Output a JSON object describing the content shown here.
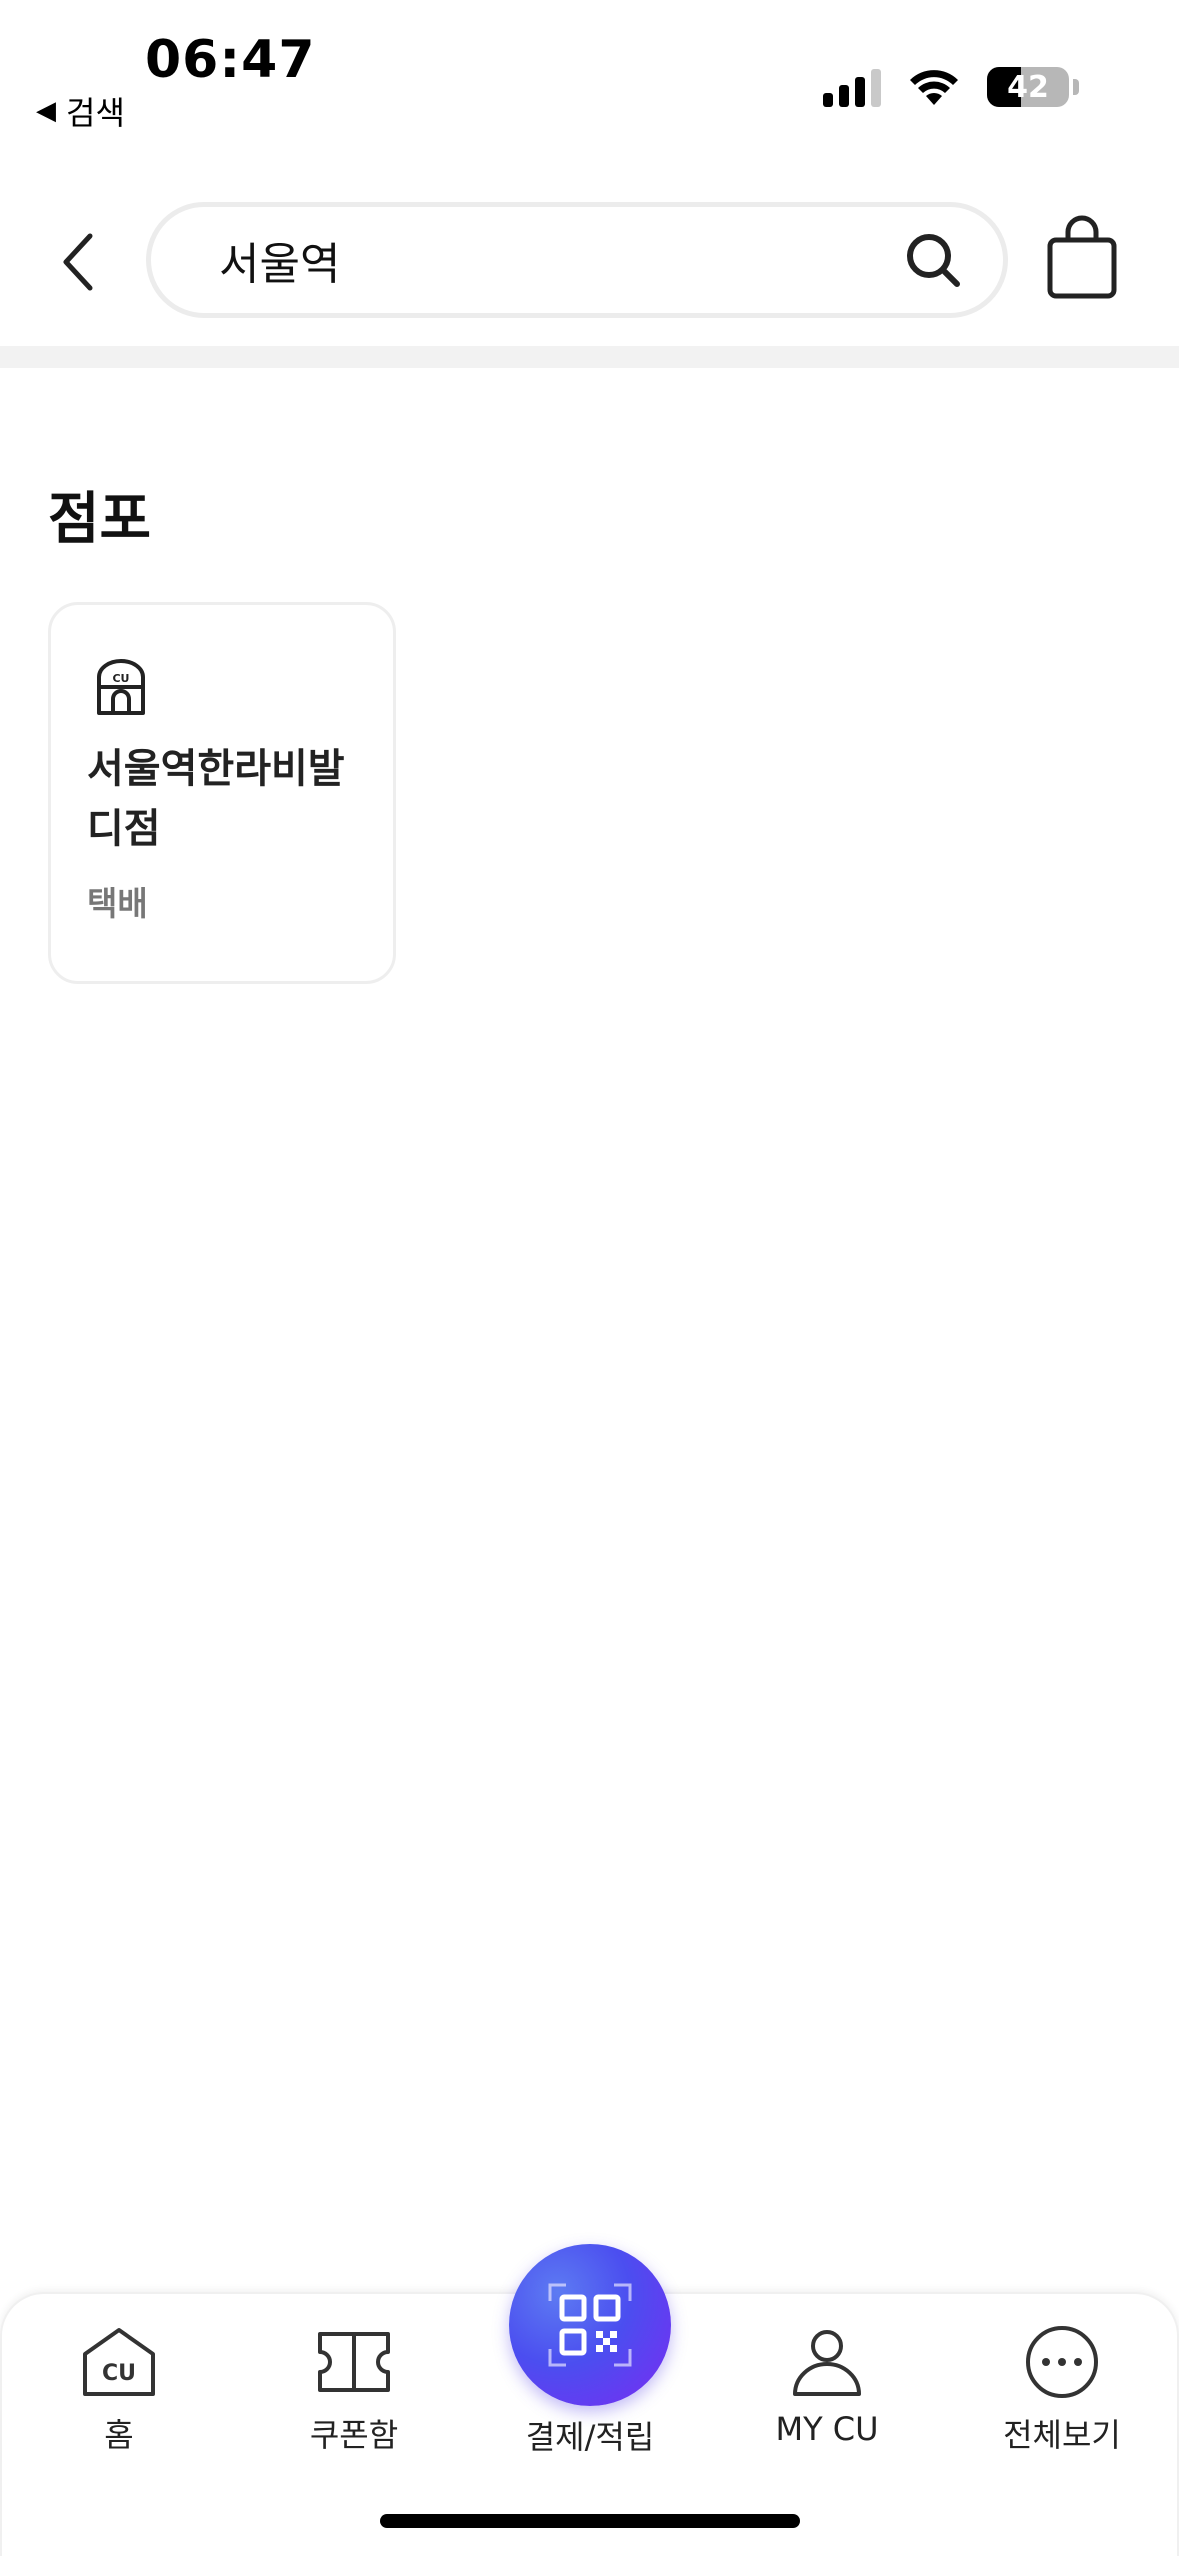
{
  "status_bar": {
    "time": "06:47",
    "back_label": "검색",
    "battery_level": "42"
  },
  "header": {
    "search_value": "서울역"
  },
  "section": {
    "title": "점포"
  },
  "stores": [
    {
      "name": "서울역한라비발디점",
      "tag": "택배"
    }
  ],
  "bottom_nav": {
    "home_label": "홈",
    "coupon_label": "쿠폰함",
    "pay_label": "결제/적립",
    "mycu_label": "MY CU",
    "more_label": "전체보기"
  },
  "colors": {
    "accent_gradient_start": "#5d7bf2",
    "accent_gradient_end": "#7a2bf2"
  }
}
